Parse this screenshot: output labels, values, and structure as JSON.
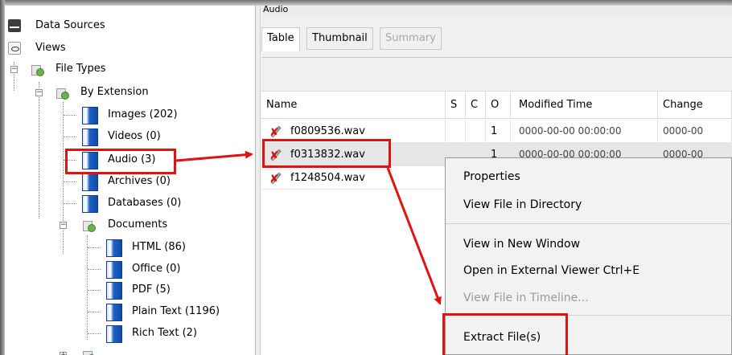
{
  "tree": {
    "items": [
      {
        "label": "Data Sources",
        "icon": "data-sources-icon"
      },
      {
        "label": "Views",
        "icon": "views-icon"
      },
      {
        "label": "File Types",
        "icon": "file-types-icon"
      },
      {
        "label": "By Extension",
        "icon": "by-extension-icon"
      },
      {
        "label": "Images (202)",
        "icon": "file-node-icon"
      },
      {
        "label": "Videos (0)",
        "icon": "file-node-icon"
      },
      {
        "label": "Audio (3)",
        "icon": "file-node-icon"
      },
      {
        "label": "Archives (0)",
        "icon": "file-node-icon"
      },
      {
        "label": "Databases (0)",
        "icon": "file-node-icon"
      },
      {
        "label": "Documents",
        "icon": "documents-icon"
      },
      {
        "label": "HTML (86)",
        "icon": "file-node-icon"
      },
      {
        "label": "Office (0)",
        "icon": "file-node-icon"
      },
      {
        "label": "PDF (5)",
        "icon": "file-node-icon"
      },
      {
        "label": "Plain Text (1196)",
        "icon": "file-node-icon"
      },
      {
        "label": "Rich Text (2)",
        "icon": "file-node-icon"
      }
    ]
  },
  "panel": {
    "title": "Audio",
    "tabs": [
      {
        "label": "Table",
        "state": "active"
      },
      {
        "label": "Thumbnail",
        "state": "normal"
      },
      {
        "label": "Summary",
        "state": "disabled"
      }
    ]
  },
  "table": {
    "columns": [
      "Name",
      "S",
      "C",
      "O",
      "Modified Time",
      "Change"
    ],
    "rows": [
      {
        "name": "f0809536.wav",
        "s": "",
        "c": "",
        "o": "1",
        "modified": "0000-00-00 00:00:00",
        "change": "0000-00"
      },
      {
        "name": "f0313832.wav",
        "s": "",
        "c": "",
        "o": "1",
        "modified": "0000-00-00 00:00:00",
        "change": "0000-00"
      },
      {
        "name": "f1248504.wav",
        "s": "",
        "c": "",
        "o": "",
        "modified": "",
        "change": ""
      }
    ],
    "selected_row": 1
  },
  "context_menu": {
    "items": [
      {
        "label": "Properties",
        "enabled": true
      },
      {
        "label": "View File in Directory",
        "enabled": true
      },
      {
        "label": "View in New Window",
        "enabled": true
      },
      {
        "label": "Open in External Viewer  Ctrl+E",
        "enabled": true
      },
      {
        "label": "View File in Timeline...",
        "enabled": false
      },
      {
        "label": "Extract File(s)",
        "enabled": true
      }
    ]
  },
  "colors": {
    "annotation": "#e2120f",
    "selection": "#e6e6e6",
    "deleted_mark": "#d01515"
  }
}
